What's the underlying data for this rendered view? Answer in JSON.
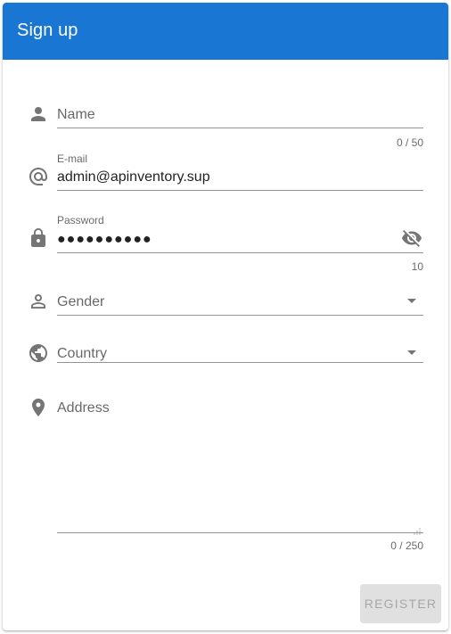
{
  "header": {
    "title": "Sign up"
  },
  "form": {
    "name": {
      "label": "Name",
      "value": "",
      "counter": "0 / 50"
    },
    "email": {
      "label": "E-mail",
      "value": "admin@apinventory.sup"
    },
    "password": {
      "label": "Password",
      "value": "●●●●●●●●●●",
      "counter": "10"
    },
    "gender": {
      "label": "Gender",
      "value": ""
    },
    "country": {
      "label": "Country",
      "value": ""
    },
    "address": {
      "label": "Address",
      "value": "",
      "counter": "0 / 250"
    }
  },
  "actions": {
    "register_label": "Register",
    "register_enabled": false
  },
  "colors": {
    "primary": "#1976d2",
    "icon": "#757575",
    "disabled_bg": "#e0e0e0"
  },
  "icons": {
    "name": "person-icon",
    "email": "at-sign-icon",
    "password": "lock-icon",
    "password_toggle": "eye-off-icon",
    "gender": "person-outline-icon",
    "country": "globe-icon",
    "address": "map-marker-icon",
    "select_arrow": "dropdown-arrow-icon"
  }
}
